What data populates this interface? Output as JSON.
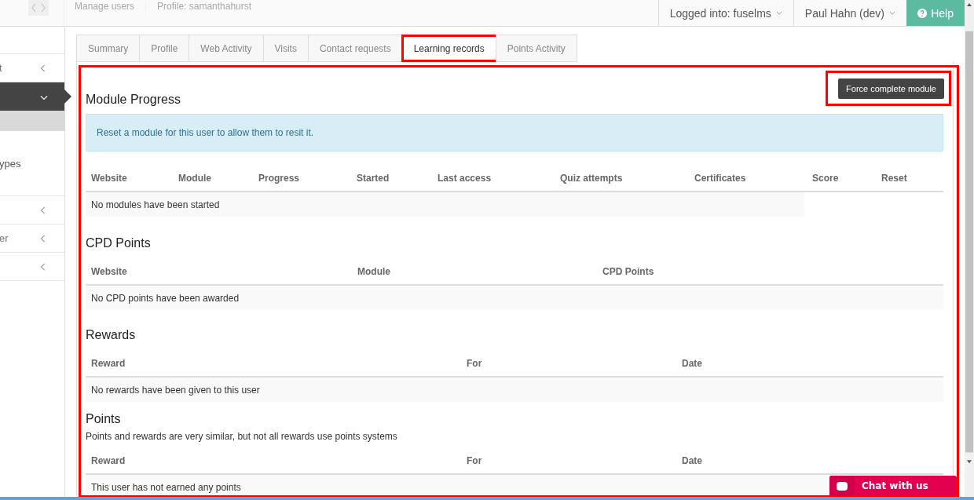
{
  "topbar": {
    "breadcrumb": [
      "Manage users",
      "Profile: samanthahurst"
    ],
    "account": "Logged into: fuselms",
    "user": "Paul Hahn (dev)",
    "help": "Help"
  },
  "sidebar": {
    "items": [
      {
        "label": "t",
        "selected": false,
        "expandable": true
      },
      {
        "selected": true,
        "expandable": true
      },
      {
        "label": "ypes",
        "selected": false,
        "expandable": false
      },
      {
        "selected": false,
        "expandable": true
      },
      {
        "label": "er",
        "selected": false,
        "expandable": true
      },
      {
        "selected": false,
        "expandable": true
      }
    ]
  },
  "tabs": [
    {
      "label": "Summary",
      "selected": false,
      "highlighted": false
    },
    {
      "label": "Profile",
      "selected": false,
      "highlighted": false
    },
    {
      "label": "Web Activity",
      "selected": false,
      "highlighted": false
    },
    {
      "label": "Visits",
      "selected": false,
      "highlighted": false
    },
    {
      "label": "Contact requests",
      "selected": false,
      "highlighted": false
    },
    {
      "label": "Learning records",
      "selected": true,
      "highlighted": true
    },
    {
      "label": "Points Activity",
      "selected": false,
      "highlighted": false
    }
  ],
  "panel": {
    "highlighted": true,
    "action": {
      "label": "Force complete module",
      "highlighted": true
    }
  },
  "sections": [
    {
      "title": "Module Progress",
      "info": "Reset a module for this user to allow them to resit it.",
      "columns": [
        "Website",
        "Module",
        "Progress",
        "Started",
        "Last access",
        "Quiz attempts",
        "Certificates",
        "Score",
        "Reset"
      ],
      "empty": "No modules have been started"
    },
    {
      "title": "CPD Points",
      "columns": [
        "Website",
        "Module",
        "CPD Points"
      ],
      "empty": "No CPD points have been awarded"
    },
    {
      "title": "Rewards",
      "columns": [
        "Reward",
        "For",
        "Date"
      ],
      "empty": "No rewards have been given to this user"
    },
    {
      "title": "Points",
      "description": "Points and rewards are very similar, but not all rewards use points systems",
      "columns": [
        "Reward",
        "For",
        "Date"
      ],
      "empty": "This user has not earned any points"
    }
  ],
  "chat": {
    "label": "Chat with us"
  }
}
